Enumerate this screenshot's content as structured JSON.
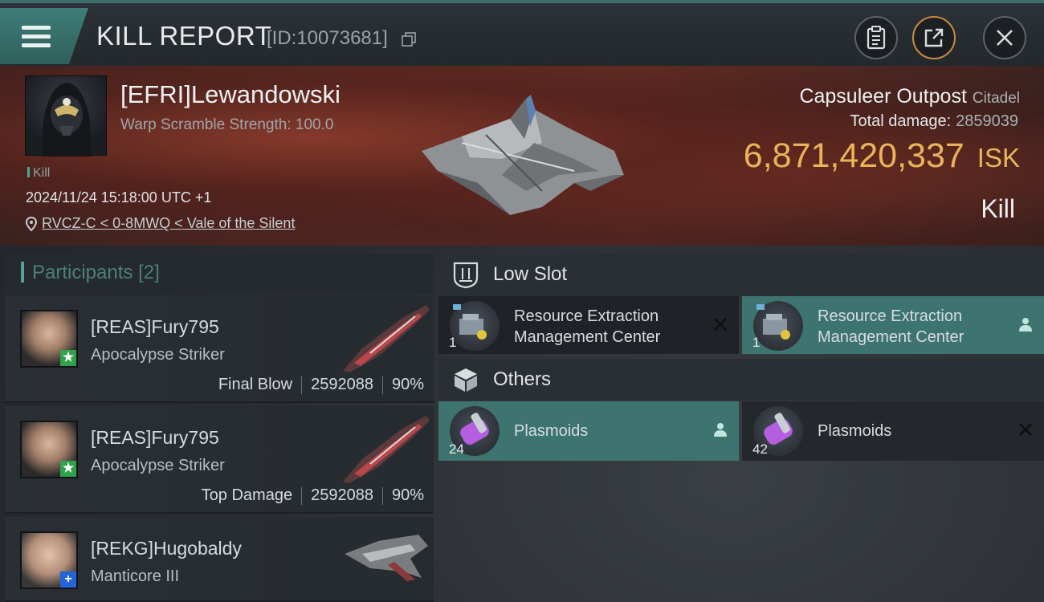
{
  "header": {
    "title": "KILL REPORT",
    "report_id": "[ID:10073681]"
  },
  "victim": {
    "name": "[EFRI]Lewandowski",
    "stat": "Warp Scramble Strength: 100.0",
    "tag": "Kill",
    "datetime": "2024/11/24 15:18:00 UTC +1",
    "location": "RVCZ-C < 0-8MWQ < Vale of the Silent",
    "target_name": "Capsuleer Outpost",
    "target_class": "Citadel",
    "total_damage_label": "Total damage:",
    "total_damage_value": "2859039",
    "isk_value": "6,871,420,337",
    "isk_unit": "ISK",
    "result": "Kill"
  },
  "participants": {
    "label": "Participants",
    "count": "[2]",
    "rows": [
      {
        "name": "[REAS]Fury795",
        "ship": "Apocalypse Striker",
        "role": "Final Blow",
        "damage": "2592088",
        "percent": "90%",
        "badge": "★",
        "badge_color": "#2fa24a"
      },
      {
        "name": "[REAS]Fury795",
        "ship": "Apocalypse Striker",
        "role": "Top Damage",
        "damage": "2592088",
        "percent": "90%",
        "badge": "★",
        "badge_color": "#2fa24a"
      },
      {
        "name": "[REKG]Hugobaldy",
        "ship": "Manticore III",
        "role": "",
        "damage": "",
        "percent": "",
        "badge": "+",
        "badge_color": "#2563d8"
      }
    ]
  },
  "low_slot": {
    "label": "Low Slot",
    "items": [
      {
        "line1": "Resource Extraction",
        "line2": "Management Center",
        "qty": "1",
        "status_icon": "close-icon"
      },
      {
        "line1": "Resource Extraction",
        "line2": "Management Center",
        "qty": "1",
        "status_icon": "person-icon"
      }
    ]
  },
  "others": {
    "label": "Others",
    "items": [
      {
        "name": "Plasmoids",
        "qty": "24",
        "status_icon": "person-icon"
      },
      {
        "name": "Plasmoids",
        "qty": "42",
        "status_icon": "close-icon"
      }
    ]
  },
  "colors": {
    "accent_teal": "#3d7470",
    "isk_gold": "#e9b45a"
  }
}
